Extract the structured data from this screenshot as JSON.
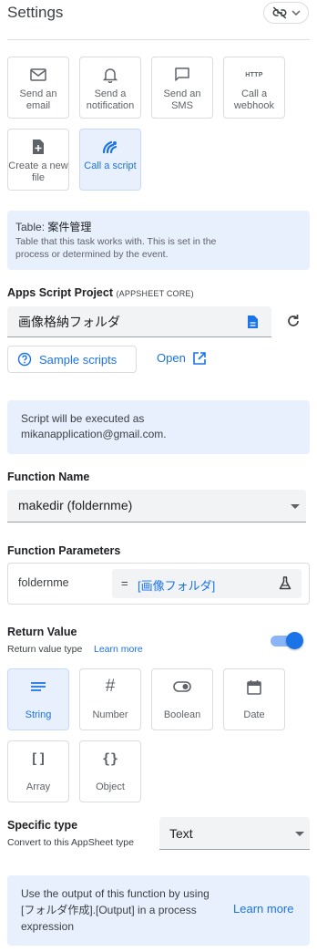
{
  "header": {
    "title": "Settings",
    "toggle_icon": "link-off-icon",
    "toggle_caret": "chevron-down-icon"
  },
  "task_types": [
    {
      "label": "Send an email",
      "icon": "mail-icon",
      "selected": false
    },
    {
      "label": "Send a notification",
      "icon": "bell-icon",
      "selected": false
    },
    {
      "label": "Send an SMS",
      "icon": "chat-icon",
      "selected": false
    },
    {
      "label": "Call a webhook",
      "icon": "http-icon",
      "icon_text": "HTTP",
      "selected": false
    },
    {
      "label": "Create a new file",
      "icon": "add-file-icon",
      "selected": false
    },
    {
      "label": "Call a script",
      "icon": "apps-script-icon",
      "selected": true
    }
  ],
  "table_info": {
    "label": "Table:",
    "value": "案件管理",
    "description": "Table that this task works with. This is set in the process or determined by the event."
  },
  "apps_script": {
    "label": "Apps Script Project",
    "tag": "(APPSHEET CORE)",
    "value": "画像格納フォルダ",
    "file_icon": "file-icon",
    "refresh_icon": "refresh-icon",
    "sample_label": "Sample scripts",
    "open_label": "Open"
  },
  "execution_note": {
    "text1": "Script will be executed as",
    "text2": "mikanapplication@gmail.com."
  },
  "function_name": {
    "label": "Function Name",
    "value": "makedir (foldernme)"
  },
  "function_params": {
    "label": "Function Parameters",
    "param_name": "foldernme",
    "equals": "=",
    "expression": "[画像フォルダ]",
    "flask_icon": "flask-icon"
  },
  "return_value": {
    "label": "Return Value",
    "sub_label": "Return value type",
    "learn_more": "Learn more",
    "enabled": true,
    "types": [
      {
        "label": "String",
        "icon": "string-icon",
        "selected": true
      },
      {
        "label": "Number",
        "icon": "hash-icon",
        "icon_text": "#",
        "selected": false
      },
      {
        "label": "Boolean",
        "icon": "toggle-icon",
        "selected": false
      },
      {
        "label": "Date",
        "icon": "calendar-icon",
        "selected": false
      },
      {
        "label": "Array",
        "icon": "brackets-icon",
        "icon_text": "[]",
        "selected": false
      },
      {
        "label": "Object",
        "icon": "braces-icon",
        "icon_text": "{}",
        "selected": false
      }
    ]
  },
  "specific_type": {
    "label": "Specific type",
    "sub_label": "Convert to this AppSheet type",
    "value": "Text"
  },
  "output_note": {
    "line1": "Use the output of this function by using",
    "line2": "[フォルダ作成].[Output] in a process",
    "line3": "expression",
    "link": "Learn more"
  },
  "colors": {
    "accent": "#1a73e8",
    "selected_bg": "#e8f0fe",
    "field_bg": "#f1f3f4",
    "border": "#dadce0"
  }
}
